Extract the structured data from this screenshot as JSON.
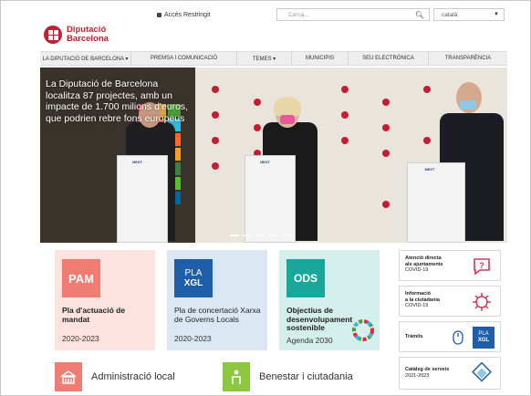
{
  "topbar": {
    "restricted_label": "Accés Restringit",
    "search_placeholder": "Cerca...",
    "language": "català"
  },
  "logo": {
    "line1": "Diputació",
    "line2": "Barcelona",
    "brand_color": "#c21f32"
  },
  "nav": {
    "items": [
      "LA DIPUTACIÓ DE BARCELONA ▾",
      "PREMSA I COMUNICACIÓ",
      "TEMES ▾",
      "MUNICIPIS",
      "SEU ELECTRÒNICA",
      "TRANSPARÈNCIA"
    ]
  },
  "hero": {
    "headline": "La Diputació de Barcelona localitza 87 projectes, amb un impacte de 1.700 milions d'euros, que podrien rebre fons europeus",
    "lectern_brand": "NEXT",
    "slides": 5,
    "active_slide": 0
  },
  "cards": [
    {
      "badge": "PAM",
      "title": "Pla d'actuació de mandat",
      "sub": "2020-2023",
      "color": "#f07c74",
      "bg": "#fde3df"
    },
    {
      "badge_line1": "PLA",
      "badge_line2": "XGL",
      "title": "Pla de concertació Xarxa de Governs Locals",
      "sub": "2020-2023",
      "color": "#1f5ea8",
      "bg": "#dbe8f3"
    },
    {
      "badge": "ODS",
      "title": "Objectius de desenvolupament sostenible",
      "sub": "Agenda 2030",
      "color": "#1aa79b",
      "bg": "#d5efec"
    }
  ],
  "side": [
    {
      "bold1": "Atenció directa",
      "bold2": "als ajuntaments",
      "sub": "COVID-19",
      "icon": "chat-question-icon"
    },
    {
      "bold1": "Informació",
      "bold2": "a la ciutadania",
      "sub": "COVID-19",
      "icon": "virus-icon"
    },
    {
      "bold1": "Tràmits",
      "icon": "plaxgl-mouse-icon",
      "badge1": "PLA",
      "badge2": "XGL"
    },
    {
      "bold1": "Catàleg de serveis",
      "sub": "2021-2023",
      "icon": "catalog-icon"
    }
  ],
  "bottom": [
    {
      "label": "Administració local",
      "color": "#f07c74",
      "icon": "building-icon"
    },
    {
      "label": "Benestar i ciutadania",
      "color": "#8dc63f",
      "icon": "person-icon"
    }
  ]
}
